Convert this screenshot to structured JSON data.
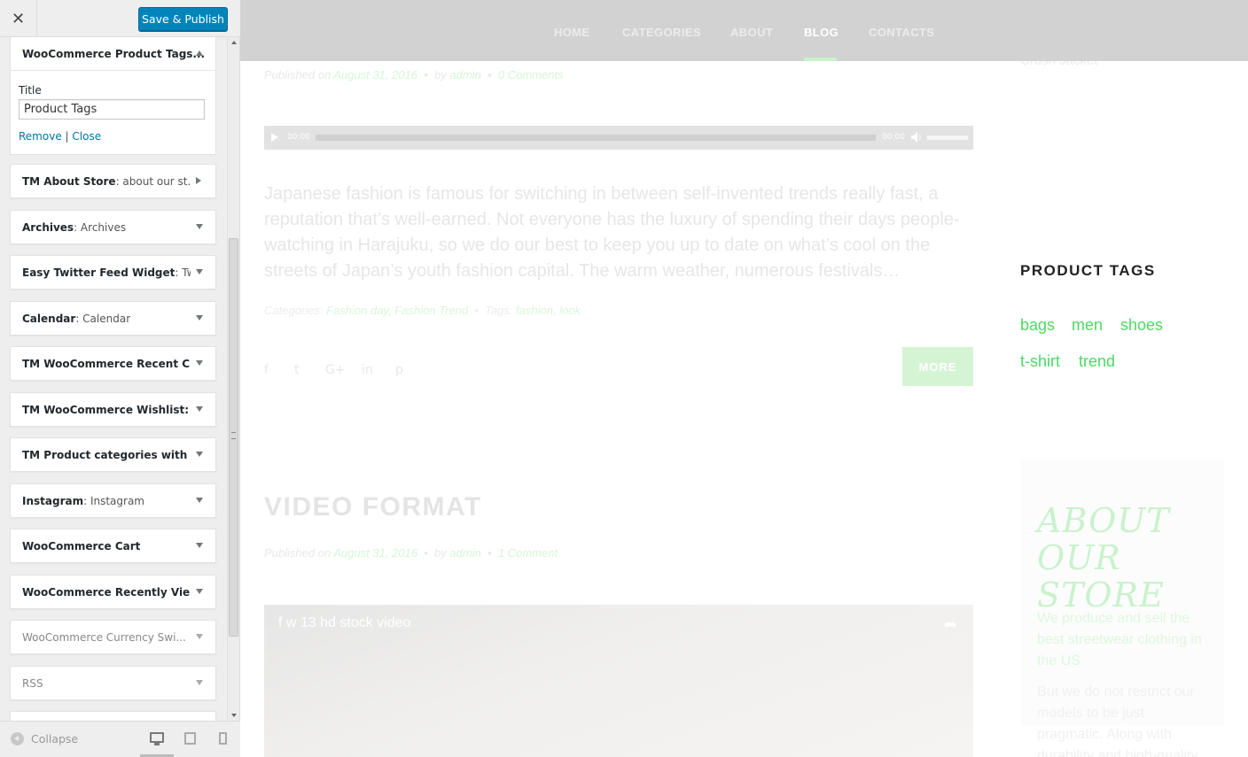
{
  "customizer": {
    "close_icon": "✕",
    "publish_label": "Save & Publish",
    "open_widget": {
      "title": "WooCommerce Product Tags...",
      "field_label": "Title",
      "field_value": "Product Tags",
      "remove_label": "Remove",
      "separator": "|",
      "close_label": "Close"
    },
    "widgets": [
      {
        "name": "TM About Store",
        "sub": ": about our st...",
        "arrow": "right"
      },
      {
        "name": "Archives",
        "sub": ": Archives",
        "arrow": "down"
      },
      {
        "name": "Easy Twitter Feed Widget",
        "sub": ": Tw...",
        "arrow": "down"
      },
      {
        "name": "Calendar",
        "sub": ": Calendar",
        "arrow": "down"
      },
      {
        "name": "TM WooCommerce Recent C...",
        "sub": "",
        "arrow": "down"
      },
      {
        "name": "TM WooCommerce Wishlist: ...",
        "sub": "",
        "arrow": "down"
      },
      {
        "name": "TM Product categories with t...",
        "sub": "",
        "arrow": "down"
      },
      {
        "name": "Instagram",
        "sub": ": Instagram",
        "arrow": "down"
      },
      {
        "name": "WooCommerce Cart",
        "sub": "",
        "arrow": "down"
      },
      {
        "name": "WooCommerce Recently Vie...",
        "sub": "",
        "arrow": "down"
      },
      {
        "name": "WooCommerce Currency Swi...",
        "sub": "",
        "arrow": "down",
        "disabled": true
      },
      {
        "name": "RSS",
        "sub": "",
        "arrow": "down",
        "disabled": true
      }
    ],
    "collapse_label": "Collapse"
  },
  "preview": {
    "nav": [
      "HOME",
      "CATEGORIES",
      "ABOUT",
      "BLOG",
      "CONTACTS"
    ],
    "nav_active": "BLOG",
    "post1": {
      "meta_prefix": "Published on",
      "date": "August 31, 2016",
      "by": "by",
      "author": "admin",
      "comments": "0 Comments",
      "dot": "•",
      "audio_time_start": "00:00",
      "audio_time_end": "00:00",
      "excerpt": "Japanese fashion is famous for switching in between self-invented trends really fast, a reputation that’s well-earned. Not everyone has the luxury of spending their days people-watching in Harajuku, so we do our best to keep you up to date on what’s cool on the streets of Japan’s youth fashion capital. The warm weather, numerous festivals…",
      "categories_label": "Categories:",
      "categories": "Fashion day, Fashion Trend",
      "tags_label": "Tags:",
      "tags": "fashion, look",
      "more_label": "MORE",
      "share_icons": [
        "f",
        "t",
        "G+",
        "in",
        "p"
      ]
    },
    "post2": {
      "title": "VIDEO FORMAT",
      "meta_prefix": "Published on",
      "date": "August 31, 2016",
      "by": "by",
      "author": "admin",
      "comments": "1 Comment",
      "dot": "•",
      "video_caption": "f w 13 hd stock video"
    },
    "sidebar": {
      "crush_text": "Crush Jacket",
      "product_tags_title": "PRODUCT TAGS",
      "tags": [
        "bags",
        "men",
        "shoes",
        "t-shirt",
        "trend"
      ],
      "about_title": "ABOUT OUR STORE",
      "about_p1": "We produce and sell the best streetwear clothing in the US",
      "about_p2": "But we do not restrict our models to be just pragmatic. Along with durability and high-quality, we add a"
    },
    "accent_color": "#4cd964",
    "publish_color": "#0085ba"
  }
}
